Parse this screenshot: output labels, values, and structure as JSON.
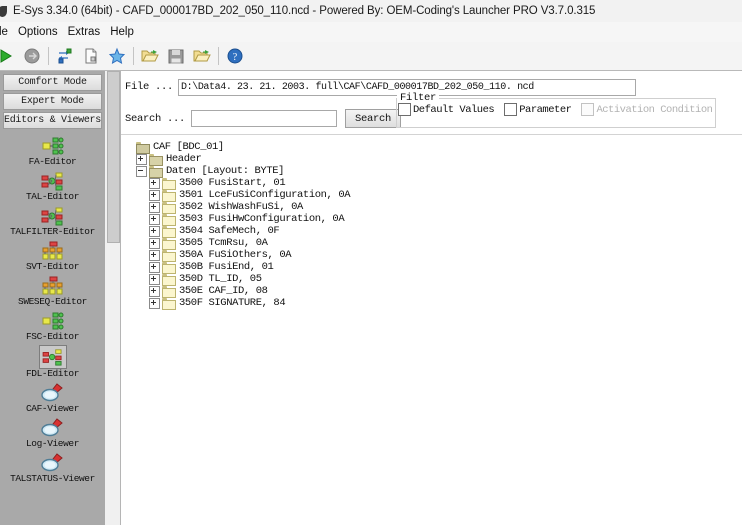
{
  "window": {
    "title": "E-Sys 3.34.0  (64bit) - CAFD_000017BD_202_050_110.ncd   - Powered By: OEM-Coding's Launcher PRO V3.7.0.315",
    "icon": "app-icon"
  },
  "menu": {
    "items": [
      {
        "label": "le",
        "name": "menu-file"
      },
      {
        "label": "Options",
        "name": "menu-options"
      },
      {
        "label": "Extras",
        "name": "menu-extras"
      },
      {
        "label": "Help",
        "name": "menu-help"
      }
    ]
  },
  "toolbar": {
    "buttons": [
      {
        "icon": "play-green-icon",
        "name": "connect-button"
      },
      {
        "icon": "arrow-gray-icon",
        "name": "disconnect-button"
      },
      {
        "icon": "transfer-icon",
        "name": "transfer-button"
      },
      {
        "icon": "document-icon",
        "name": "new-document-button"
      },
      {
        "icon": "star-blue-icon",
        "name": "favorites-button"
      },
      {
        "icon": "folder-open-icon",
        "name": "open-file-button"
      },
      {
        "icon": "save-disk-icon",
        "name": "save-file-button"
      },
      {
        "icon": "folder-open-green-icon",
        "name": "open-recent-button"
      },
      {
        "icon": "help-blue-icon",
        "name": "help-button"
      }
    ]
  },
  "sidebar": {
    "comfort_mode": "Comfort Mode",
    "expert_mode": "Expert Mode",
    "section_title": "Editors & Viewers",
    "items": [
      {
        "label": "FA-Editor",
        "icon": "fa-editor-icon",
        "selected": false
      },
      {
        "label": "TAL-Editor",
        "icon": "tal-editor-icon",
        "selected": false
      },
      {
        "label": "TALFILTER-Editor",
        "icon": "talfilter-editor-icon",
        "selected": false
      },
      {
        "label": "SVT-Editor",
        "icon": "svt-editor-icon",
        "selected": false
      },
      {
        "label": "SWESEQ-Editor",
        "icon": "sweseq-editor-icon",
        "selected": false
      },
      {
        "label": "FSC-Editor",
        "icon": "fsc-editor-icon",
        "selected": false
      },
      {
        "label": "FDL-Editor",
        "icon": "fdl-editor-icon",
        "selected": true
      },
      {
        "label": "CAF-Viewer",
        "icon": "magnifier-icon",
        "selected": false
      },
      {
        "label": "Log-Viewer",
        "icon": "magnifier-icon",
        "selected": false
      },
      {
        "label": "TALSTATUS-Viewer",
        "icon": "magnifier-icon",
        "selected": false
      }
    ]
  },
  "main": {
    "file_label": "File ...",
    "file_path": "D:\\Data4. 23. 21. 2003. full\\CAF\\CAFD_000017BD_202_050_110. ncd",
    "search_label": "Search ...",
    "search_value": "",
    "search_placeholder": "",
    "search_button": "Search",
    "filter": {
      "legend": "Filter",
      "checkboxes": [
        {
          "label": "Default Values",
          "checked": false,
          "disabled": false,
          "name": "filter-default-values-checkbox"
        },
        {
          "label": "Parameter",
          "checked": false,
          "disabled": false,
          "name": "filter-parameter-checkbox"
        },
        {
          "label": "Activation Condition",
          "checked": false,
          "disabled": true,
          "name": "filter-activation-condition-checkbox"
        }
      ]
    }
  },
  "tree": {
    "nodes": [
      {
        "label": "CAF [BDC_01]",
        "expander": "none",
        "depth": 1,
        "folder": "root"
      },
      {
        "label": "Header",
        "expander": "plus",
        "depth": 2,
        "folder": "dark"
      },
      {
        "label": "Daten [Layout: BYTE]",
        "expander": "minus",
        "depth": 2,
        "folder": "dark"
      },
      {
        "label": "3500 FusiStart, 01",
        "expander": "plus",
        "depth": 3,
        "folder": "light"
      },
      {
        "label": "3501 LceFuSiConfiguration, 0A",
        "expander": "plus",
        "depth": 3,
        "folder": "light"
      },
      {
        "label": "3502 WishWashFuSi, 0A",
        "expander": "plus",
        "depth": 3,
        "folder": "light"
      },
      {
        "label": "3503 FusiHwConfiguration, 0A",
        "expander": "plus",
        "depth": 3,
        "folder": "light"
      },
      {
        "label": "3504 SafeMech, 0F",
        "expander": "plus",
        "depth": 3,
        "folder": "light"
      },
      {
        "label": "3505 TcmRsu, 0A",
        "expander": "plus",
        "depth": 3,
        "folder": "light"
      },
      {
        "label": "350A FuSiOthers, 0A",
        "expander": "plus",
        "depth": 3,
        "folder": "light"
      },
      {
        "label": "350B FusiEnd, 01",
        "expander": "plus",
        "depth": 3,
        "folder": "light"
      },
      {
        "label": "350D TL_ID, 05",
        "expander": "plus",
        "depth": 3,
        "folder": "light"
      },
      {
        "label": "350E CAF_ID, 08",
        "expander": "plus",
        "depth": 3,
        "folder": "light"
      },
      {
        "label": "350F SIGNATURE, 84",
        "expander": "plus",
        "depth": 3,
        "folder": "light"
      }
    ]
  },
  "colors": {
    "titlebar_bg": "#f2f2f2",
    "toolbar_bg": "#f4f4f4",
    "sidebar_bg": "#a9a9a9",
    "panel_bg": "#ffffff",
    "folder_fill": "#fbf6cf",
    "accent_green": "#1e9e1e",
    "accent_blue": "#2f6fbf"
  }
}
